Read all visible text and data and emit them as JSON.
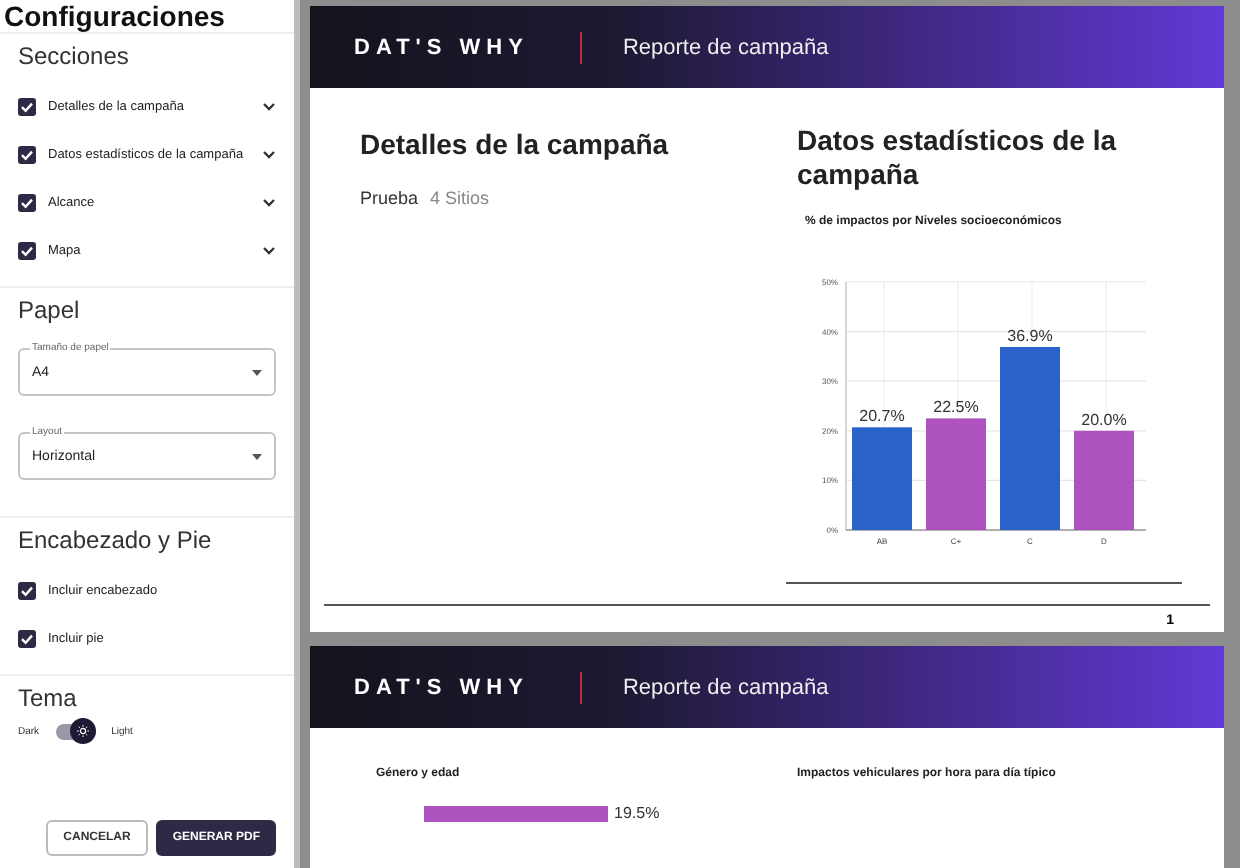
{
  "sidebar": {
    "title": "Configuraciones",
    "sections_title": "Secciones",
    "sections": [
      {
        "label": "Detalles de la campaña",
        "checked": true,
        "expanded": false
      },
      {
        "label": "Datos estadísticos de la campaña",
        "checked": true,
        "expanded": false
      },
      {
        "label": "Alcance",
        "checked": true,
        "expanded": false
      },
      {
        "label": "Mapa",
        "checked": true,
        "expanded": false
      }
    ],
    "paper_title": "Papel",
    "paper_fields": [
      {
        "label": "Tamaño de papel",
        "value": "A4"
      },
      {
        "label": "Layout",
        "value": "Horizontal"
      }
    ],
    "header_title": "Encabezado y Pie",
    "header_options": [
      {
        "label": "Incluir encabezado",
        "checked": true
      },
      {
        "label": "Incluir pie",
        "checked": true
      }
    ],
    "theme_title": "Tema",
    "theme": {
      "off_label": "Dark",
      "on_label": "Light",
      "on": true
    },
    "buttons": [
      {
        "label": "CANCELAR",
        "kind": "outlined"
      },
      {
        "label": "GENERAR PDF",
        "kind": "filled"
      }
    ]
  },
  "pages": [
    {
      "logo": "DAT'S WHY",
      "header_title": "Reporte de campaña",
      "details_title": "Detalles de la campaña",
      "details_name": "Prueba",
      "details_sites": "4 Sitios",
      "stats_title": "Datos estadísticos de la campaña",
      "chart_data": {
        "type": "bar",
        "title": "% de impactos por Niveles socioeconómicos",
        "categories": [
          "AB",
          "C+",
          "C",
          "D"
        ],
        "series": [
          {
            "color": "#2962c9",
            "values": [
              20.7,
              null,
              36.9,
              null
            ]
          },
          {
            "color": "#ad52bf",
            "values": [
              null,
              22.5,
              null,
              20.0
            ]
          }
        ],
        "ylim": [
          0,
          50
        ],
        "grid": true,
        "yticks": [
          {
            "value": 0,
            "label": "0%"
          },
          {
            "value": 10,
            "label": "10%"
          },
          {
            "value": 20,
            "label": "20%"
          },
          {
            "value": 30,
            "label": "30%"
          },
          {
            "value": 40,
            "label": "40%"
          },
          {
            "value": 50,
            "label": "50%"
          }
        ],
        "value_labels": [
          "20.7%",
          "22.5%",
          "36.9%",
          "20.0%"
        ]
      },
      "page_number": "1"
    },
    {
      "logo": "DAT'S WHY",
      "header_title": "Reporte de campaña",
      "left_chart_title": "Género y edad",
      "left_bar_value": "19.5%",
      "right_chart_title": "Impactos vehiculares por hora para día típico"
    }
  ]
}
